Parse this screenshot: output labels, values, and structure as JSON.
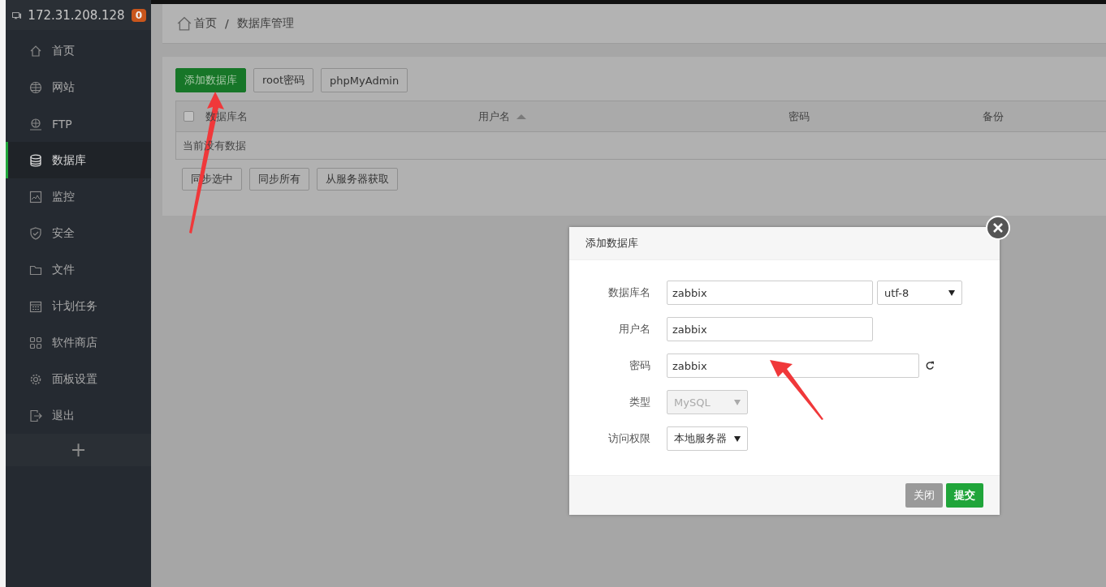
{
  "sidebar": {
    "host": "172.31.208.128",
    "badge": "0",
    "items": [
      {
        "label": "首页",
        "selected": false
      },
      {
        "label": "网站",
        "selected": false
      },
      {
        "label": "FTP",
        "selected": false
      },
      {
        "label": "数据库",
        "selected": true
      },
      {
        "label": "监控",
        "selected": false
      },
      {
        "label": "安全",
        "selected": false
      },
      {
        "label": "文件",
        "selected": false
      },
      {
        "label": "计划任务",
        "selected": false
      },
      {
        "label": "软件商店",
        "selected": false
      },
      {
        "label": "面板设置",
        "selected": false
      },
      {
        "label": "退出",
        "selected": false
      }
    ],
    "add_label": "+"
  },
  "breadcrumb": [
    "首页",
    "/",
    "数据库管理"
  ],
  "toolbar": [
    {
      "label": "添加数据库",
      "primary": true
    },
    {
      "label": "root密码",
      "primary": false
    },
    {
      "label": "phpMyAdmin",
      "primary": false
    }
  ],
  "table": {
    "select_all": {
      "checked": false
    },
    "columns": [
      {
        "label": "数据库名",
        "sorted": false
      },
      {
        "label": "用户名",
        "sorted": true
      },
      {
        "label": "密码",
        "sorted": false
      },
      {
        "label": "备份",
        "sorted": false
      }
    ],
    "empty_message": "当前没有数据"
  },
  "footer_buttons": [
    "同步选中",
    "同步所有",
    "从服务器获取"
  ],
  "dialog": {
    "title": "添加数据库",
    "rows": [
      {
        "label": "数据库名",
        "controls": [
          {
            "kind": "text",
            "value": "zabbix"
          },
          {
            "kind": "select",
            "value": "utf-8",
            "disabled": false
          }
        ]
      },
      {
        "label": "用户名",
        "controls": [
          {
            "kind": "text",
            "value": "zabbix"
          }
        ]
      },
      {
        "label": "密码",
        "controls": [
          {
            "kind": "text",
            "value": "zabbix"
          },
          {
            "kind": "refresh"
          }
        ]
      },
      {
        "label": "类型",
        "controls": [
          {
            "kind": "select",
            "value": "MySQL",
            "disabled": true
          }
        ]
      },
      {
        "label": "访问权限",
        "controls": [
          {
            "kind": "select",
            "value": "本地服务器",
            "disabled": false
          }
        ]
      }
    ],
    "buttons": [
      {
        "label": "关闭",
        "primary": false
      },
      {
        "label": "提交",
        "primary": true
      }
    ]
  }
}
